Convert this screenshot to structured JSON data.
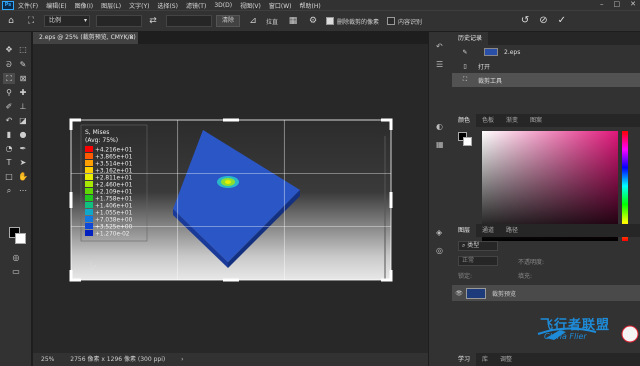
{
  "menu": {
    "items": [
      "文件(F)",
      "编辑(E)",
      "图像(I)",
      "图层(L)",
      "文字(Y)",
      "选择(S)",
      "滤镜(T)",
      "3D(D)",
      "视图(V)",
      "窗口(W)",
      "帮助(H)"
    ]
  },
  "options": {
    "ratio_label": "比例",
    "straighten_label": "拉直",
    "clear_label": "清除",
    "delete_cropped_label": "删除裁剪的像素",
    "content_aware_label": "内容识别"
  },
  "document": {
    "tab_title": "2.eps @ 25% (裁剪预览, CMYK/8) *",
    "zoom": "25%",
    "size": "2756 像素 x 1296 像素 (300 ppi)"
  },
  "history": {
    "tab": "历史记录",
    "items": [
      "2.eps",
      "打开",
      "裁剪工具"
    ]
  },
  "color_panel": {
    "tabs": [
      "颜色",
      "色板",
      "渐变",
      "图案"
    ]
  },
  "layers_panel": {
    "tabs": [
      "图层",
      "通道",
      "路径"
    ],
    "kind_label": "类型",
    "blend_mode": "正常",
    "opacity_label": "不透明度:",
    "lock_label": "锁定:",
    "fill_label": "填充:",
    "layer_name": "裁剪预览"
  },
  "bottom_tabs": [
    "学习",
    "库",
    "调整"
  ],
  "legend": {
    "title1": "S, Mises",
    "title2": "(Avg: 75%)",
    "values": [
      "+4.216e+01",
      "+3.865e+01",
      "+3.514e+01",
      "+3.162e+01",
      "+2.811e+01",
      "+2.460e+01",
      "+2.109e+01",
      "+1.758e+01",
      "+1.406e+01",
      "+1.055e+01",
      "+7.038e+00",
      "+3.525e+00",
      "+1.270e-02"
    ],
    "colors": [
      "#ff0000",
      "#ff5a00",
      "#ffa000",
      "#ffd000",
      "#e8f000",
      "#a8e800",
      "#60d800",
      "#20c820",
      "#10c080",
      "#10a8c8",
      "#1078e0",
      "#1048d8",
      "#0020c0"
    ]
  },
  "watermark": {
    "text": "飞行者联盟",
    "sub": "China Flier"
  }
}
